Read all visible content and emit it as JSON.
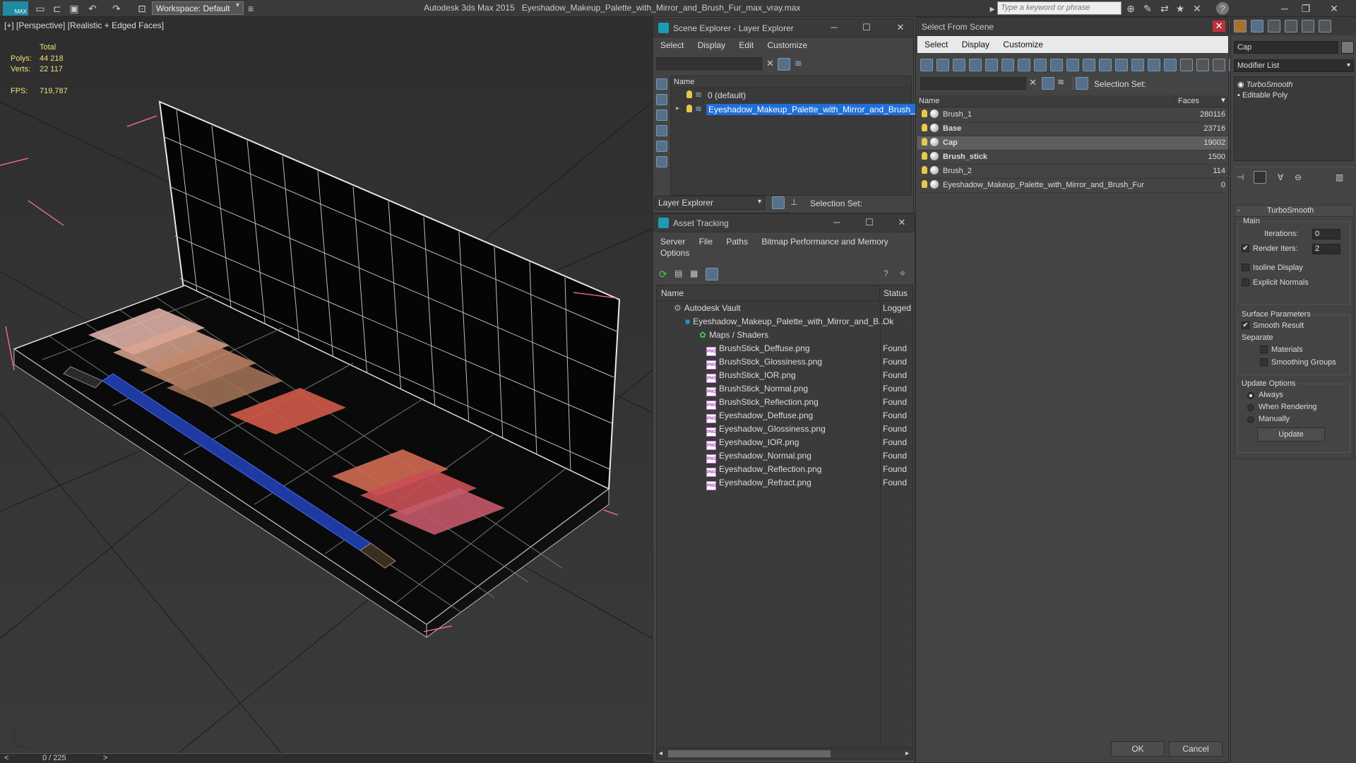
{
  "app": {
    "title": "Autodesk 3ds Max  2015",
    "file": "Eyeshadow_Makeup_Palette_with_Mirror_and_Brush_Fur_max_vray.max",
    "logo": "MAX",
    "workspace": "Workspace: Default",
    "search_placeholder": "Type a keyword or phrase"
  },
  "viewport": {
    "label": "[+] [Perspective] [Realistic + Edged Faces]",
    "stats_header": "Total",
    "polys_label": "Polys:",
    "polys": "44 218",
    "verts_label": "Verts:",
    "verts": "22 117",
    "fps_label": "FPS:",
    "fps": "719,787"
  },
  "timeline": {
    "frame": "0 / 225",
    "prev": "<",
    "next": ">"
  },
  "scene_explorer": {
    "title": "Scene Explorer - Layer Explorer",
    "menu": [
      "Select",
      "Display",
      "Edit",
      "Customize"
    ],
    "col_name": "Name",
    "rows": [
      {
        "label": "0 (default)"
      },
      {
        "label": "Eyeshadow_Makeup_Palette_with_Mirror_and_Brush_Fur"
      }
    ],
    "footer_label": "Layer Explorer",
    "selection_set": "Selection Set:"
  },
  "asset_tracking": {
    "title": "Asset Tracking",
    "menu": [
      "Server",
      "File",
      "Paths",
      "Bitmap Performance and Memory"
    ],
    "menu2": "Options",
    "col_name": "Name",
    "col_status": "Status",
    "rows": [
      {
        "name": "Autodesk Vault",
        "status": "Logged"
      },
      {
        "name": "Eyeshadow_Makeup_Palette_with_Mirror_and_B...",
        "status": "Ok"
      },
      {
        "name": "Maps / Shaders",
        "status": ""
      },
      {
        "name": "BrushStick_Deffuse.png",
        "status": "Found"
      },
      {
        "name": "BrushStick_Glossiness.png",
        "status": "Found"
      },
      {
        "name": "BrushStick_IOR.png",
        "status": "Found"
      },
      {
        "name": "BrushStick_Normal.png",
        "status": "Found"
      },
      {
        "name": "BrushStick_Reflection.png",
        "status": "Found"
      },
      {
        "name": "Eyeshadow_Deffuse.png",
        "status": "Found"
      },
      {
        "name": "Eyeshadow_Glossiness.png",
        "status": "Found"
      },
      {
        "name": "Eyeshadow_IOR.png",
        "status": "Found"
      },
      {
        "name": "Eyeshadow_Normal.png",
        "status": "Found"
      },
      {
        "name": "Eyeshadow_Reflection.png",
        "status": "Found"
      },
      {
        "name": "Eyeshadow_Refract.png",
        "status": "Found"
      }
    ],
    "png_badge": "PNG"
  },
  "select_from_scene": {
    "title": "Select From Scene",
    "menu": [
      "Select",
      "Display",
      "Customize"
    ],
    "selection_set": "Selection Set:",
    "col_name": "Name",
    "col_faces": "Faces",
    "rows": [
      {
        "name": "Brush_1",
        "faces": "280116"
      },
      {
        "name": "Base",
        "faces": "23716"
      },
      {
        "name": "Cap",
        "faces": "19002"
      },
      {
        "name": "Brush_stick",
        "faces": "1500"
      },
      {
        "name": "Brush_2",
        "faces": "114"
      },
      {
        "name": "Eyeshadow_Makeup_Palette_with_Mirror_and_Brush_Fur",
        "faces": "0"
      }
    ],
    "ok": "OK",
    "cancel": "Cancel"
  },
  "command_panel": {
    "object_name": "Cap",
    "modifier_list": "Modifier List",
    "stack": [
      "TurboSmooth",
      "Editable Poly"
    ],
    "rollout": "TurboSmooth",
    "main": "Main",
    "iterations_label": "Iterations:",
    "iterations": "0",
    "render_iters_label": "Render Iters:",
    "render_iters": "2",
    "isoline": "Isoline Display",
    "explicit_normals": "Explicit Normals",
    "surface_params": "Surface Parameters",
    "smooth_result": "Smooth Result",
    "separate": "Separate",
    "materials": "Materials",
    "smoothing_groups": "Smoothing Groups",
    "update_options": "Update Options",
    "always": "Always",
    "when_rendering": "When Rendering",
    "manually": "Manually",
    "update": "Update",
    "collapse": "-",
    "check": "✔"
  }
}
